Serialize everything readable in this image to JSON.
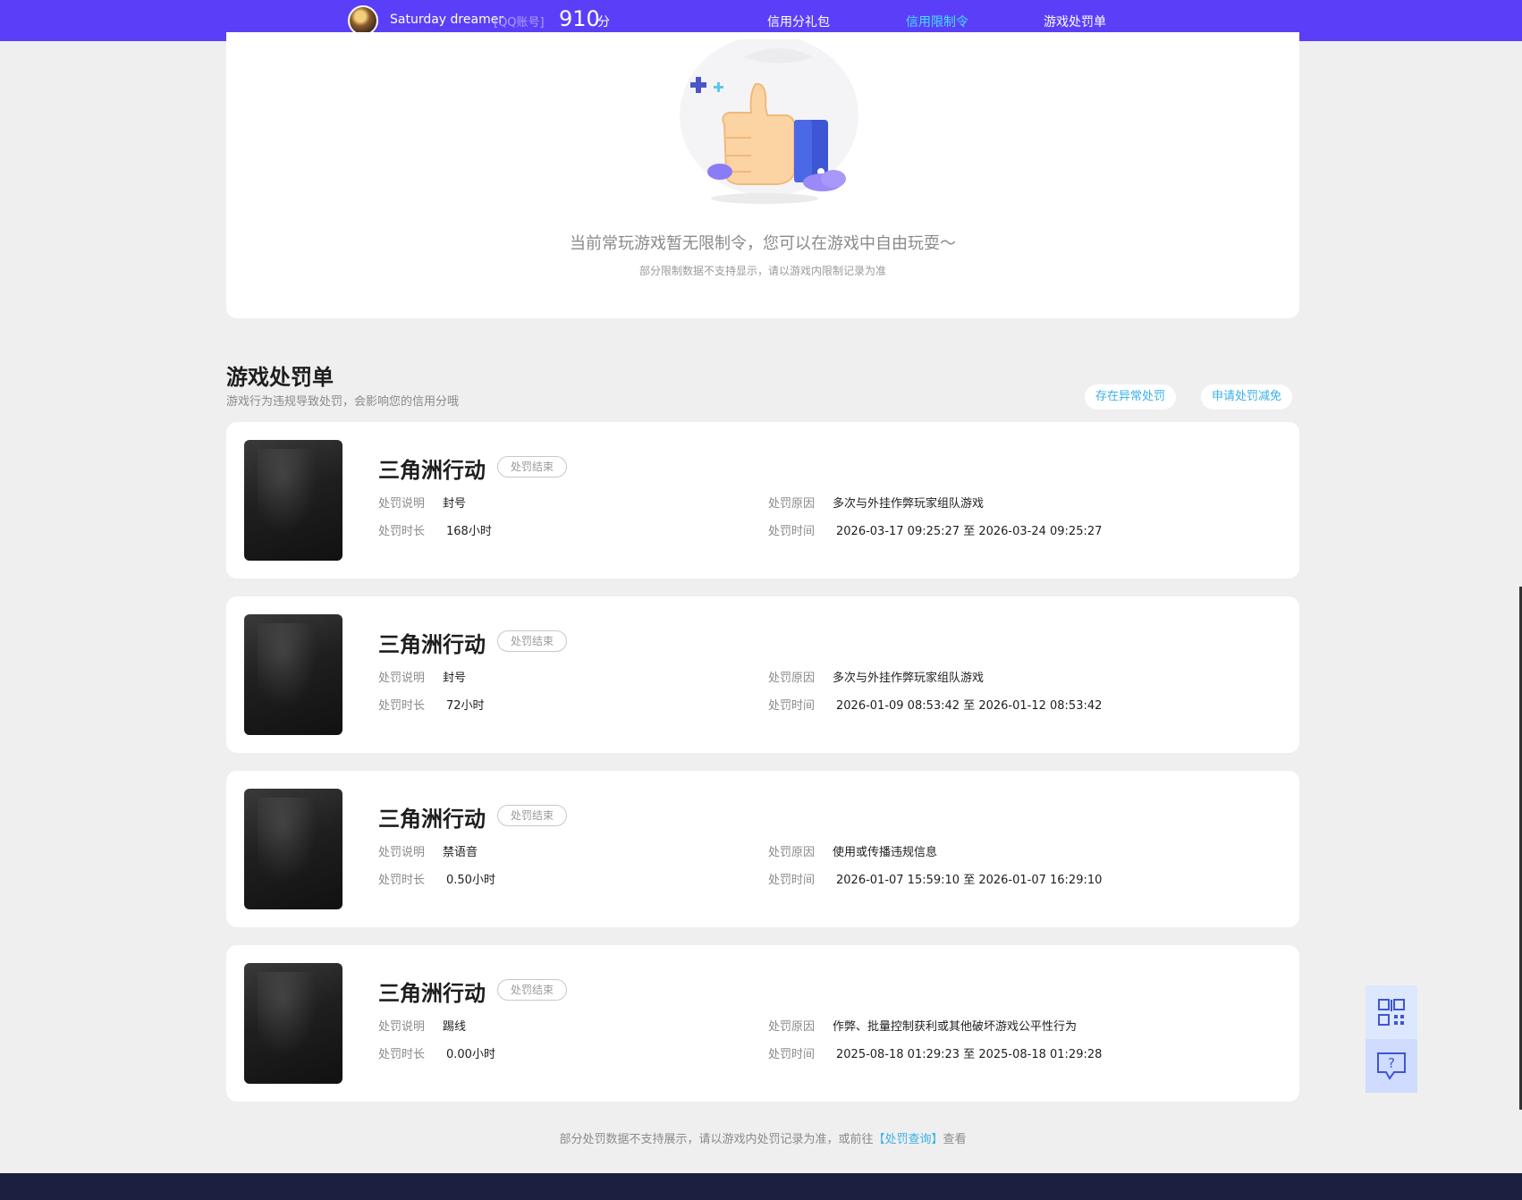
{
  "nav": {
    "username": "Saturday dreamer",
    "account_type": "[QQ账号]",
    "score": "910",
    "score_unit": "分",
    "tabs": [
      {
        "label": "信用分礼包",
        "active": false
      },
      {
        "label": "信用限制令",
        "active": true
      },
      {
        "label": "游戏处罚单",
        "active": false
      }
    ]
  },
  "restriction": {
    "empty_message": "当前常玩游戏暂无限制令，您可以在游戏中自由玩耍～",
    "note": "部分限制数据不支持显示，请以游戏内限制记录为准"
  },
  "penalties": {
    "title": "游戏处罚单",
    "subtitle": "游戏行为违规导致处罚，会影响您的信用分哦",
    "actions": [
      "存在异常处罚",
      "申请处罚减免"
    ],
    "labels": {
      "desc": "处罚说明",
      "duration": "处罚时长",
      "reason": "处罚原因",
      "time": "处罚时间"
    },
    "items": [
      {
        "game": "三角洲行动",
        "status": "处罚结束",
        "desc": "封号",
        "duration": "168小时",
        "reason": "多次与外挂作弊玩家组队游戏",
        "time": "2026-03-17 09:25:27 至 2026-03-24 09:25:27"
      },
      {
        "game": "三角洲行动",
        "status": "处罚结束",
        "desc": "封号",
        "duration": "72小时",
        "reason": "多次与外挂作弊玩家组队游戏",
        "time": "2026-01-09 08:53:42 至 2026-01-12 08:53:42"
      },
      {
        "game": "三角洲行动",
        "status": "处罚结束",
        "desc": "禁语音",
        "duration": "0.50小时",
        "reason": "使用或传播违规信息",
        "time": "2026-01-07 15:59:10 至 2026-01-07 16:29:10"
      },
      {
        "game": "三角洲行动",
        "status": "处罚结束",
        "desc": "踢线",
        "duration": "0.00小时",
        "reason": "作弊、批量控制获利或其他破坏游戏公平性行为",
        "time": "2025-08-18 01:29:23 至 2025-08-18 01:29:28"
      }
    ]
  },
  "footer": {
    "note_prefix": "部分处罚数据不支持展示，请以游戏内处罚记录为准，或前往",
    "link": "【处罚查询】",
    "note_suffix": "查看"
  },
  "icons": {
    "qr": "qr-code-icon",
    "help": "help-chat-icon"
  },
  "colors": {
    "nav_bg": "#5b3ff8",
    "accent": "#45e0ff",
    "link": "#3ab0e8"
  }
}
